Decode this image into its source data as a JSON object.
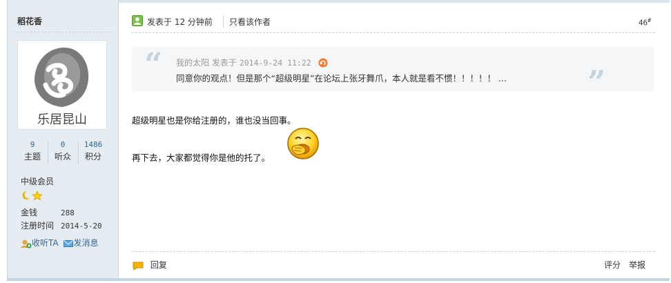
{
  "author": {
    "name": "稻花香",
    "avatar_text": "乐居昆山",
    "stats": [
      {
        "num": "9",
        "label": "主题"
      },
      {
        "num": "0",
        "label": "听众"
      },
      {
        "num": "1486",
        "label": "积分"
      }
    ],
    "group": "中级会员",
    "money_label": "金钱",
    "money_value": "288",
    "reg_label": "注册时间",
    "reg_value": "2014-5-20",
    "follow_label": "收听TA",
    "message_label": "发消息"
  },
  "post": {
    "posted_at": "发表于 12 分钟前",
    "only_author": "只看该作者",
    "floor": "46",
    "floor_mark": "#",
    "quote": {
      "author_line": "我的太阳 发表于",
      "date": "2014-9-24 11:22",
      "text": "同意你的观点！但是那个“超级明星”在论坛上张牙舞爪，本人就是看不惯！！！！！ ..."
    },
    "line1": "超级明星也是你给注册的，谁也没当回事。",
    "line2": "再下去，大家都觉得你是他的托了。",
    "reply_label": "回复",
    "rate_label": "评分",
    "report_label": "举报"
  },
  "colors": {
    "sidebar_bg": "#e5edf2",
    "border": "#c2d5e3",
    "link": "#336699",
    "quote_bg": "#f4f6f8"
  }
}
